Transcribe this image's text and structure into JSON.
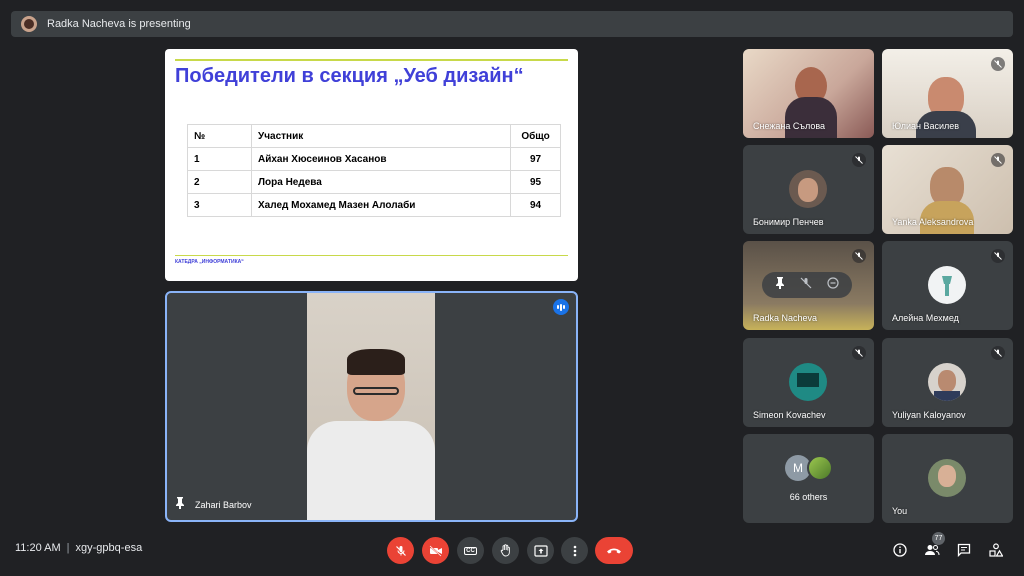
{
  "topbar": {
    "text": "Radka Nacheva is presenting"
  },
  "slide": {
    "title": "Победители в секция „Уеб дизайн“",
    "table": {
      "headers": [
        "№",
        "Участник",
        "Общо"
      ],
      "rows": [
        [
          "1",
          "Айхан Хюсеинов Хасанов",
          "97"
        ],
        [
          "2",
          "Лора Недева",
          "95"
        ],
        [
          "3",
          "Халед Мохамед Мазен Алолаби",
          "94"
        ]
      ]
    },
    "footer": "КАТЕДРА „ИНФОРМАТИКА“"
  },
  "speaker": {
    "name": "Zahari Barbov"
  },
  "participants": [
    {
      "name": "Снежана Сълова"
    },
    {
      "name": "Юлиан Василев"
    },
    {
      "name": "Бонимир Пенчев"
    },
    {
      "name": "Yanka Aleksandrova"
    },
    {
      "name": "Radka Nacheva"
    },
    {
      "name": "Алейна Мехмед"
    },
    {
      "name": "Simeon Kovachev"
    },
    {
      "name": "Yuliyan Kaloyanov"
    },
    {
      "name": "66 others",
      "initial": "M"
    },
    {
      "name": "You"
    }
  ],
  "bottombar": {
    "time": "11:20 AM",
    "meeting_code": "xgy-gpbq-esa",
    "cc_label": "CC",
    "participants_count": "77"
  },
  "colors": {
    "accent": "#1a73e8",
    "danger": "#ea4335",
    "slide_title": "#4040d8",
    "slide_rule": "#c8d94a"
  }
}
